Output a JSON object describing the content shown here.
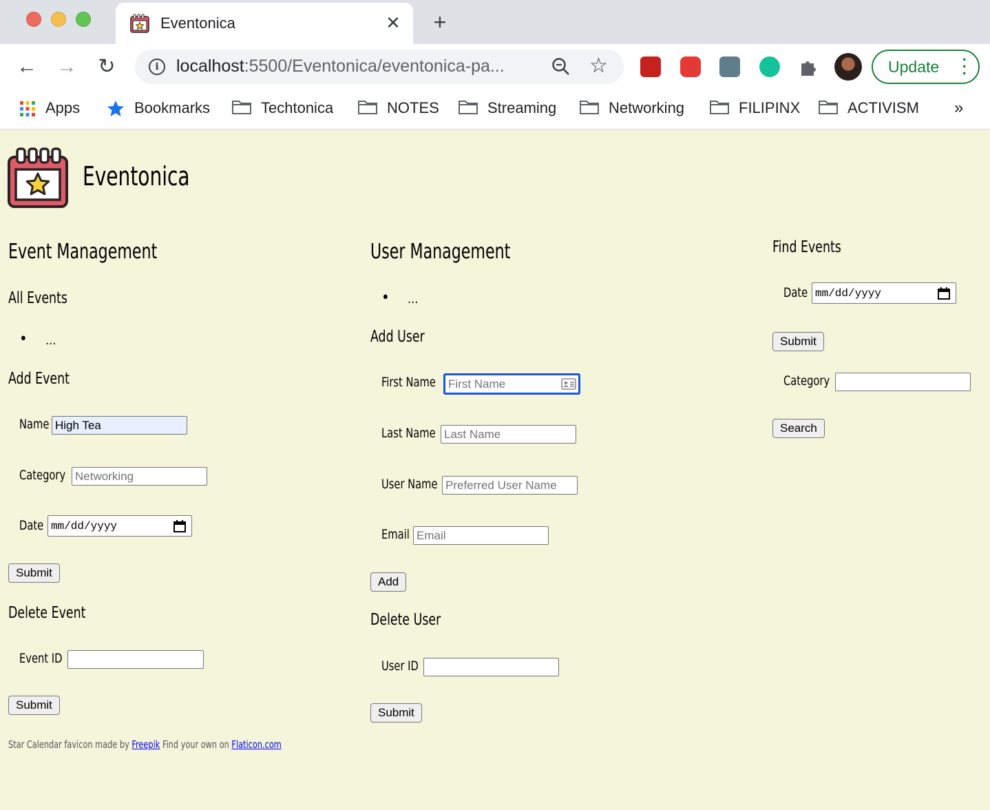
{
  "browser": {
    "tab_title": "Eventonica",
    "tab_close": "✕",
    "new_tab": "+",
    "url_host": "localhost",
    "url_rest": ":5500/Eventonica/eventonica-pa...",
    "update_label": "Update",
    "bookmarks": {
      "apps": "Apps",
      "bookmarks": "Bookmarks",
      "techtonica": "Techtonica",
      "notes": "NOTES",
      "streaming": "Streaming",
      "networking": "Networking",
      "filipinx": "FILIPINX",
      "activism": "ACTIVISM",
      "more": "»"
    }
  },
  "site": {
    "title": "Eventonica"
  },
  "event_management": {
    "heading": "Event Management",
    "all_events_heading": "All Events",
    "all_events_item": "...",
    "add_event_heading": "Add Event",
    "name_label": "Name",
    "name_value": "High Tea",
    "category_label": "Category",
    "category_placeholder": "Networking",
    "date_label": "Date",
    "date_placeholder": "mm/dd/yyyy",
    "submit_label": "Submit",
    "delete_event_heading": "Delete Event",
    "event_id_label": "Event ID",
    "delete_submit_label": "Submit"
  },
  "user_management": {
    "heading": "User Management",
    "users_item": "...",
    "add_user_heading": "Add User",
    "first_name_label": "First Name",
    "first_name_placeholder": "First Name",
    "last_name_label": "Last Name",
    "last_name_placeholder": "Last Name",
    "user_name_label": "User Name",
    "user_name_placeholder": "Preferred User Name",
    "email_label": "Email",
    "email_placeholder": "Email",
    "add_label": "Add",
    "delete_user_heading": "Delete User",
    "user_id_label": "User ID",
    "delete_submit_label": "Submit"
  },
  "find_events": {
    "heading": "Find Events",
    "date_label": "Date",
    "date_placeholder": "mm/dd/yyyy",
    "submit_label": "Submit",
    "category_label": "Category",
    "search_label": "Search"
  },
  "footer": {
    "prefix": "Star Calendar favicon made by ",
    "freepik": "Freepik",
    "middle": " Find your own on ",
    "flaticon": "Flaticon.com"
  },
  "colors": {
    "page_background": "#f5f5dc",
    "update_green": "#188038",
    "focus_blue": "#1a56db",
    "logo_red": "#e05a6a"
  }
}
